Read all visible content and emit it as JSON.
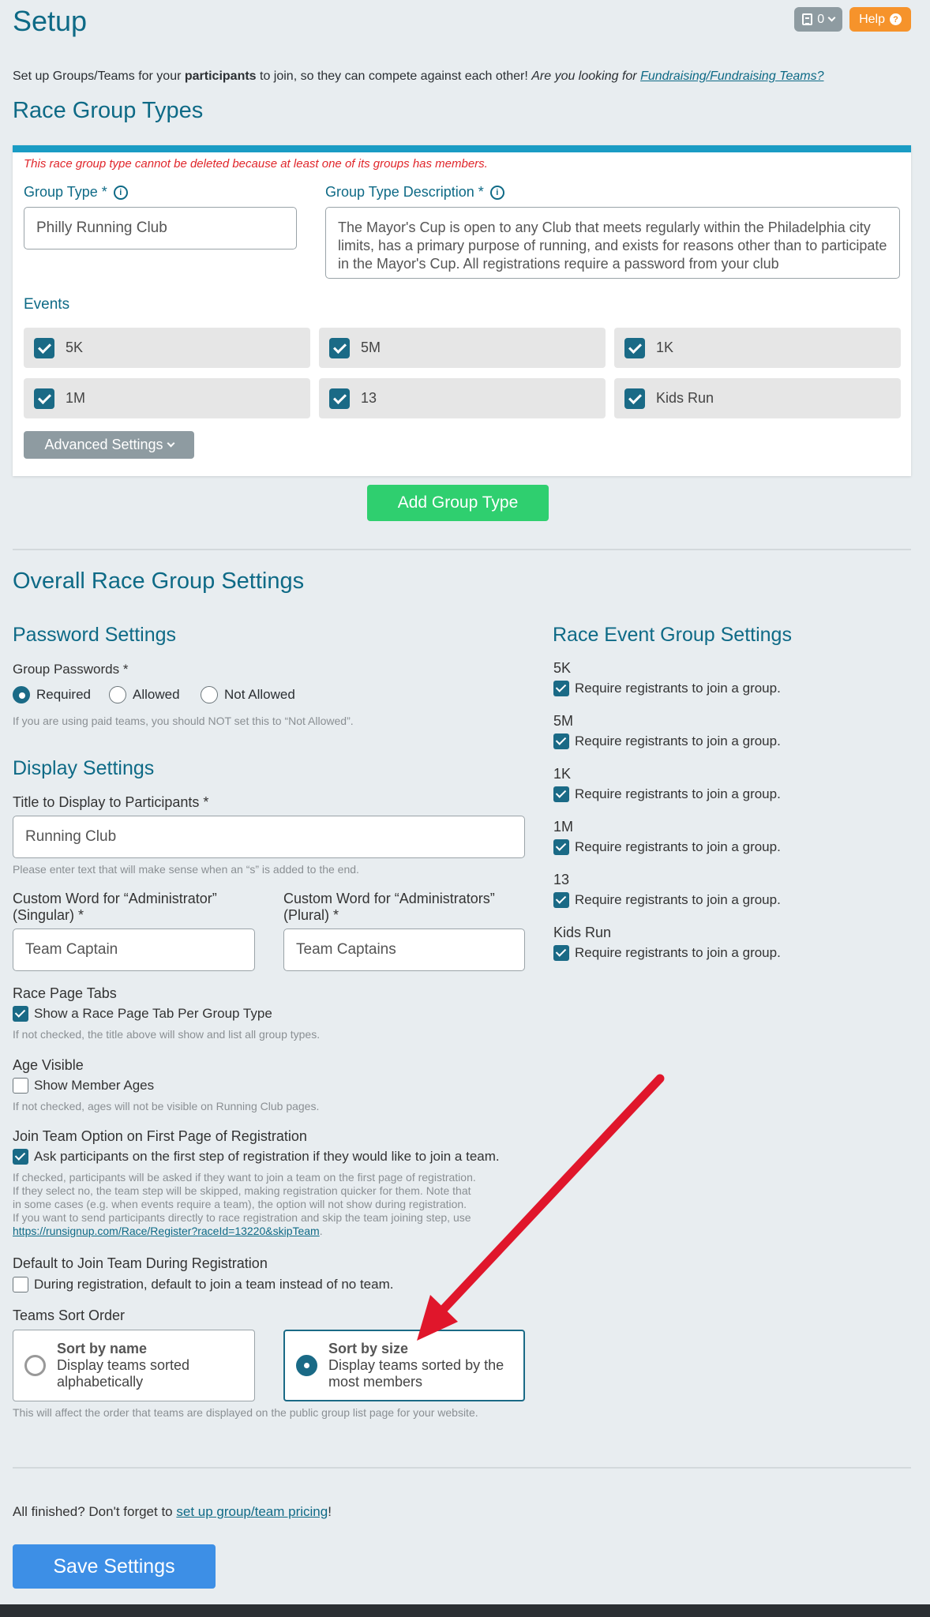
{
  "header": {
    "title": "Setup",
    "badge_count": "0",
    "help_label": "Help"
  },
  "intro": {
    "prefix": "Set up Groups/Teams for your ",
    "bold": "participants",
    "middle": " to join, so they can compete against each other! ",
    "italic": "Are you looking for ",
    "link": "Fundraising/Fundraising Teams?"
  },
  "race_group_types": {
    "heading": "Race Group Types",
    "warning": "This race group type cannot be deleted because at least one of its groups has members.",
    "group_type_label": "Group Type *",
    "group_type_value": "Philly Running Club",
    "description_label": "Group Type Description *",
    "description_value": "The Mayor's Cup is open to any Club that meets regularly within the Philadelphia city limits, has a primary purpose of running, and exists for reasons other than to participate in the Mayor's Cup.  All registrations require a password from your club",
    "events_label": "Events",
    "events": [
      "5K",
      "5M",
      "1K",
      "1M",
      "13",
      "Kids Run"
    ],
    "advanced_label": "Advanced Settings",
    "add_button": "Add Group Type"
  },
  "overall": {
    "heading": "Overall Race Group Settings"
  },
  "password": {
    "heading": "Password Settings",
    "label": "Group Passwords *",
    "options": [
      "Required",
      "Allowed",
      "Not Allowed"
    ],
    "selected": "Required",
    "help": "If you are using paid teams, you should NOT set this to “Not Allowed”."
  },
  "display": {
    "heading": "Display Settings",
    "title_label": "Title to Display to Participants *",
    "title_value": "Running Club",
    "title_help": "Please enter text that will make sense when an “s” is added to the end.",
    "admin_singular_label_1": "Custom Word for “Administrator”",
    "admin_singular_label_2": "(Singular) *",
    "admin_singular_value": "Team Captain",
    "admin_plural_label_1": "Custom Word for “Administrators”",
    "admin_plural_label_2": "(Plural) *",
    "admin_plural_value": "Team Captains",
    "tabs_label": "Race Page Tabs",
    "tabs_check": "Show a Race Page Tab Per Group Type",
    "tabs_help": "If not checked, the title above will show and list all group types.",
    "age_label": "Age Visible",
    "age_check": "Show Member Ages",
    "age_help": "If not checked, ages will not be visible on Running Club pages.",
    "join_label": "Join Team Option on First Page of Registration",
    "join_check": "Ask participants on the first step of registration if they would like to join a team.",
    "join_help_1": "If checked, participants will be asked if they want to join a team on the first page of registration.",
    "join_help_2": "If they select no, the team step will be skipped, making registration quicker for them. Note that",
    "join_help_3": "in some cases (e.g. when events require a team), the option will not show during registration.",
    "join_help_4": "If you want to send participants directly to race registration and skip the team joining step, use",
    "join_help_link": "https://runsignup.com/Race/Register?raceId=13220&skipTeam",
    "default_label": "Default to Join Team During Registration",
    "default_check": "During registration, default to join a team instead of no team.",
    "sort_label": "Teams Sort Order",
    "sort_name_title": "Sort by name",
    "sort_name_desc_1": "Display teams sorted",
    "sort_name_desc_2": "alphabetically",
    "sort_size_title": "Sort by size",
    "sort_size_desc_1": "Display teams sorted by the",
    "sort_size_desc_2": "most members",
    "sort_help": "This will affect the order that teams are displayed on the public group list page for your website."
  },
  "event_groups": {
    "heading": "Race Event Group Settings",
    "require_text": "Require registrants to join a group.",
    "events": [
      "5K",
      "5M",
      "1K",
      "1M",
      "13",
      "Kids Run"
    ]
  },
  "footer": {
    "prefix": "All finished? Don't forget to ",
    "link": "set up group/team pricing",
    "suffix": "!",
    "save_button": "Save Settings"
  },
  "colors": {
    "accent": "#0e6a86",
    "add_button": "#2fcf6f",
    "save_button": "#3d8fe6",
    "help_button": "#f6932b",
    "warning": "#e0262b",
    "annotation_arrow": "#e0162b"
  }
}
